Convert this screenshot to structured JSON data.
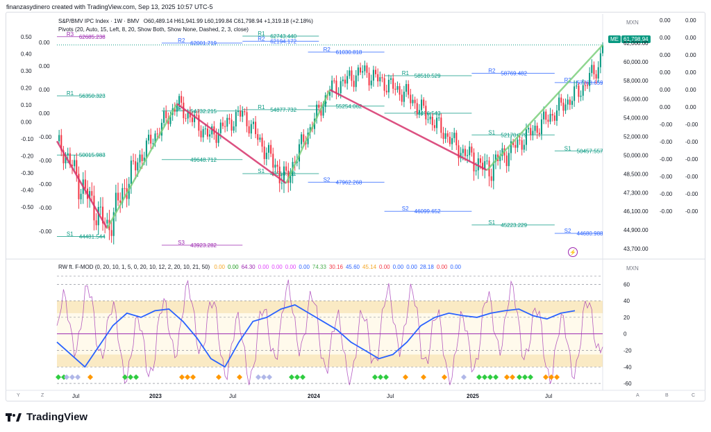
{
  "caption": "finanzasydinero created with TradingView.com, Sep 13, 2025 10:57 UTC-5",
  "header": {
    "symbol": "S&P/BMV IPC Index · 1W · BMV",
    "ohlc": "O60,489.14 H61,941.99 L60,199.84 C61,798.94 +1,319.18 (+2.18%)",
    "pivots": "Pivots (20, Auto, 15, Left, 8, 20, Show Both, Show None, Dashed, 2, 3, close)"
  },
  "currency": "MXN",
  "price_badge": {
    "prefix": "ME",
    "value": "61,798.94",
    "color": "#089981"
  },
  "indicator": {
    "title": "RW ft. F-MOD (0, 20, 10, 1, 5, 0, 20, 10, 12, 2, 20, 10, 21, 50)",
    "values": [
      {
        "t": "0.00",
        "c": "#f5a623"
      },
      {
        "t": "0.00",
        "c": "#1e9b1e"
      },
      {
        "t": "64.30",
        "c": "#9c27b0"
      },
      {
        "t": "0.00",
        "c": "#e040fb"
      },
      {
        "t": "0.00",
        "c": "#e040fb"
      },
      {
        "t": "0.00",
        "c": "#e040fb"
      },
      {
        "t": "0.00",
        "c": "#2962ff"
      },
      {
        "t": "74.33",
        "c": "#4caf50"
      },
      {
        "t": "30.16",
        "c": "#f23645"
      },
      {
        "t": "45.60",
        "c": "#2962ff"
      },
      {
        "t": "45.14",
        "c": "#f5a623"
      },
      {
        "t": "0.00",
        "c": "#f23645"
      },
      {
        "t": "0.00",
        "c": "#2962ff"
      },
      {
        "t": "0.00",
        "c": "#2962ff"
      },
      {
        "t": "28.18",
        "c": "#2962ff"
      },
      {
        "t": "0.00",
        "c": "#f23645"
      },
      {
        "t": "0.00",
        "c": "#2962ff"
      }
    ],
    "currency": "MXN"
  },
  "bottom_buttons": [
    "Y",
    "Z",
    "A",
    "B",
    "C"
  ],
  "brand": "TradingView",
  "colors": {
    "up": "#089981",
    "down": "#f23645",
    "zigzag_up": "#7ccf7c",
    "zigzag_down": "#d6336c"
  },
  "chart_data": [
    {
      "type": "candlestick",
      "title": "S&P/BMV IPC Index · 1W · BMV",
      "y_ticks": [
        "62,000.00",
        "60,000.00",
        "58,000.00",
        "56,000.00",
        "54,000.00",
        "52,000.00",
        "50,000.00",
        "48,500.00",
        "47,300.00",
        "46,100.00",
        "44,900.00",
        "43,700.00"
      ],
      "x_ticks": [
        "Jul",
        "2023",
        "Jul",
        "2024",
        "Jul",
        "2025",
        "Jul"
      ],
      "close_path": [
        [
          0,
          51500
        ],
        [
          10,
          48000
        ],
        [
          23,
          45000
        ],
        [
          40,
          50500
        ],
        [
          55,
          55500
        ],
        [
          70,
          52000
        ],
        [
          85,
          54500
        ],
        [
          97,
          50000
        ],
        [
          105,
          47900
        ],
        [
          125,
          57000
        ],
        [
          140,
          59000
        ],
        [
          160,
          56500
        ],
        [
          175,
          53000
        ],
        [
          185,
          50500
        ],
        [
          197,
          48800
        ],
        [
          210,
          51000
        ],
        [
          225,
          54000
        ],
        [
          240,
          57000
        ],
        [
          248,
          59500
        ],
        [
          250,
          61799
        ]
      ],
      "last_close": 61798.94,
      "pivot_levels": [
        {
          "label": "R3",
          "value": "62685.238"
        },
        {
          "label": "R2",
          "value": "62001.719"
        },
        {
          "label": "R1",
          "value": "62743.440"
        },
        {
          "label": "R2",
          "value": "61030.818"
        },
        {
          "label": "R1",
          "value": "58510.529"
        },
        {
          "label": "R2",
          "value": "58769.482"
        },
        {
          "label": "R2",
          "value": "57768.659"
        },
        {
          "label": "R1",
          "value": "56350.323"
        },
        {
          "label": "R1",
          "value": "54732.215"
        },
        {
          "label": "R1",
          "value": "54877.732"
        },
        {
          "label": "P",
          "value": "55254.062"
        },
        {
          "label": "",
          "value": "54496.543"
        },
        {
          "label": "S1",
          "value": "52170.179"
        },
        {
          "label": "S1",
          "value": "50457.557"
        },
        {
          "label": "",
          "value": "50015.983"
        },
        {
          "label": "",
          "value": "49648.712"
        },
        {
          "label": "S1",
          "value": "48518.811"
        },
        {
          "label": "S2",
          "value": "47962.268"
        },
        {
          "label": "S2",
          "value": "46099.652"
        },
        {
          "label": "S1",
          "value": "45223.229"
        },
        {
          "label": "S2",
          "value": "44680.988"
        },
        {
          "label": "S1",
          "value": "44481.544"
        },
        {
          "label": "S3",
          "value": "43923.282"
        },
        {
          "label": "R2",
          "value": "62194.172"
        }
      ],
      "left_scale_col1": [
        "0.50",
        "0.40",
        "0.30",
        "0.20",
        "0.10",
        "0.00",
        "-0.10",
        "-0.20",
        "-0.30",
        "-0.40",
        "-0.50"
      ],
      "left_scale_col2": [
        "0.00",
        "0.00",
        "0.00",
        "0.00",
        "-0.00",
        "-0.00",
        "-0.00",
        "-0.00",
        "-0.00"
      ],
      "right_scale_col1": [
        "0.00",
        "0.00",
        "0.00",
        "0.00",
        "0.00",
        "0.00",
        "-0.00",
        "-0.00",
        "-0.00",
        "-0.00",
        "-0.00",
        "-0.00"
      ],
      "right_scale_col2": [
        "0.00",
        "0.00",
        "0.00",
        "0.00",
        "0.00",
        "0.00",
        "-0.00",
        "-0.00",
        "-0.00",
        "-0.00",
        "-0.00",
        "-0.00"
      ]
    },
    {
      "type": "line",
      "title": "RW ft. F-MOD",
      "y_ticks": [
        "60",
        "40",
        "20",
        "0",
        "-20",
        "-40",
        "-60"
      ],
      "ylim": [
        -65,
        72
      ],
      "series": [
        {
          "values": [
            -10,
            -25,
            -40,
            -15,
            10,
            25,
            20,
            28,
            30,
            15,
            -5,
            -30,
            -40,
            -10,
            15,
            20,
            30,
            35,
            25,
            15,
            5,
            -10,
            -20,
            -30,
            -25,
            -10,
            10,
            20,
            25,
            22,
            20,
            25,
            28,
            30,
            22,
            18,
            25,
            28
          ]
        }
      ]
    }
  ]
}
